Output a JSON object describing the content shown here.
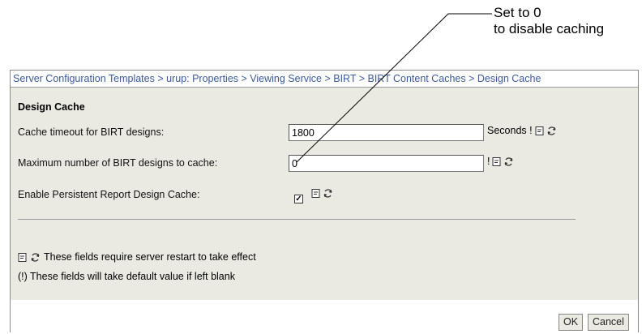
{
  "callout": {
    "line1": "Set to 0",
    "line2": "to disable caching"
  },
  "breadcrumb": "Server Configuration Templates > urup: Properties > Viewing Service > BIRT > BIRT Content Caches > Design Cache",
  "section_title": "Design Cache",
  "fields": {
    "timeout": {
      "label": "Cache timeout for BIRT designs:",
      "value": "1800",
      "suffix": "Seconds !"
    },
    "max_designs": {
      "label": "Maximum number of BIRT designs to cache:",
      "value": "0",
      "suffix": "!"
    },
    "persistent": {
      "label": "Enable Persistent Report Design Cache:",
      "checked": true
    }
  },
  "notes": {
    "restart": "These fields require server restart to take effect",
    "default": "(!) These fields will take default value if left blank"
  },
  "buttons": {
    "ok": "OK",
    "cancel": "Cancel"
  },
  "icons": {
    "restart": "restart-doc-icon",
    "refresh": "refresh-icon"
  },
  "colors": {
    "breadcrumb_link": "#3c5a9a",
    "panel_bg": "#ebeae2"
  }
}
